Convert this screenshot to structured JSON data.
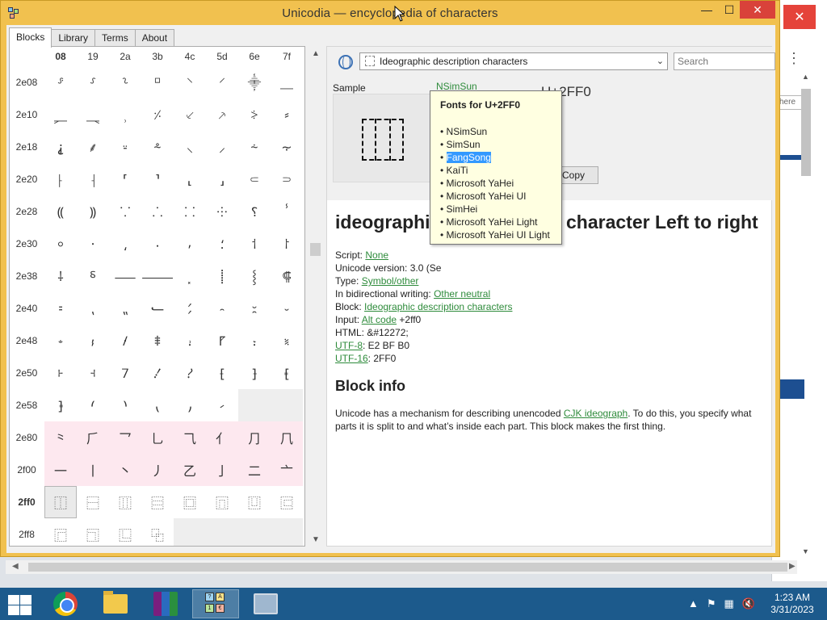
{
  "window": {
    "title": "Unicodia — encyclopedia of characters",
    "minimize": "—",
    "maximize": "☐",
    "close": "✕"
  },
  "tabs": [
    "Blocks",
    "Library",
    "Terms",
    "About"
  ],
  "grid": {
    "columns": [
      "08",
      "19",
      "2a",
      "3b",
      "4c",
      "5d",
      "6e",
      "7f"
    ],
    "rows": [
      {
        "label": "2e08",
        "cells": [
          "⸈",
          "⸉",
          "⸊",
          "⸋",
          "⸌",
          "⸍",
          "⸎",
          "⸏"
        ]
      },
      {
        "label": "2e10",
        "cells": [
          "⸐",
          "⸑",
          "⸒",
          "⸓",
          "⸔",
          "⸕",
          "⸖",
          "⸗"
        ]
      },
      {
        "label": "2e18",
        "cells": [
          "⸘",
          "⸙",
          "⸚",
          "⸛",
          "⸜",
          "⸝",
          "⸞",
          "⸟"
        ]
      },
      {
        "label": "2e20",
        "cells": [
          "⸠",
          "⸡",
          "⸢",
          "⸣",
          "⸤",
          "⸥",
          "⸦",
          "⸧"
        ]
      },
      {
        "label": "2e28",
        "cells": [
          "⸨",
          "⸩",
          "⸪",
          "⸫",
          "⸬",
          "⸭",
          "⸮",
          "ⸯ"
        ]
      },
      {
        "label": "2e30",
        "cells": [
          "⸰",
          "⸱",
          "⸲",
          "⸳",
          "⸴",
          "⸵",
          "⸶",
          "⸷"
        ]
      },
      {
        "label": "2e38",
        "cells": [
          "⸸",
          "⸹",
          "⸺",
          "⸻",
          "⸼",
          "⸽",
          "⸾",
          "⸿"
        ]
      },
      {
        "label": "2e40",
        "cells": [
          "⹀",
          "⹁",
          "⹂",
          "⹃",
          "⹄",
          "⹅",
          "⹆",
          "⹇"
        ]
      },
      {
        "label": "2e48",
        "cells": [
          "⹈",
          "⹉",
          "⹊",
          "⹋",
          "⹌",
          "⹍",
          "⹎",
          "⹏"
        ]
      },
      {
        "label": "2e50",
        "cells": [
          "⹐",
          "⹑",
          "⹒",
          "⹓",
          "⹔",
          "⹕",
          "⹖",
          "⹗"
        ]
      },
      {
        "label": "2e58",
        "cells": [
          "⹘",
          "⹙",
          "⹚",
          "⹛",
          "⹜",
          "⹝",
          "",
          ""
        ]
      },
      {
        "label": "2e80",
        "cells": [
          "⺀",
          "⺁",
          "⺂",
          "⺃",
          "⺄",
          "⺅",
          "⺆",
          "⺇"
        ]
      },
      {
        "label": "2f00",
        "cells": [
          "⼀",
          "⼁",
          "⼂",
          "⼃",
          "⼄",
          "⼅",
          "⼆",
          "⼇"
        ]
      },
      {
        "label": "2ff0",
        "cells": [
          "⿰",
          "⿱",
          "⿲",
          "⿳",
          "⿴",
          "⿵",
          "⿶",
          "⿷"
        ]
      },
      {
        "label": "2ff8",
        "cells": [
          "⿸",
          "⿹",
          "⿺",
          "⿻",
          "",
          "",
          "",
          ""
        ]
      }
    ]
  },
  "block_select": "Ideographic description characters",
  "search_placeholder": "Search",
  "sample_label": "Sample",
  "font_link": "NSimSun",
  "code_label": "U+2FF0",
  "copy_button": "Copy",
  "heading_start": "ideographi",
  "heading_end": "character Left to right",
  "props": {
    "script_label": "Script:",
    "script_value": "None",
    "version": "Unicode version: 3.0 (Se",
    "type_label": "Type:",
    "type_value": "Symbol/other",
    "bidi_label": "In bidirectional writing:",
    "bidi_value": "Other neutral",
    "block_label": "Block:",
    "block_value": "Ideographic description characters",
    "input_label": "Input:",
    "input_link": "Alt code",
    "input_value": "+2ff0",
    "html": "HTML: &#12272;",
    "utf8_link": "UTF-8",
    "utf8_value": ": E2 BF B0",
    "utf16_link": "UTF-16",
    "utf16_value": ": 2FF0"
  },
  "block_info": {
    "heading": "Block info",
    "text_before": "Unicode has a mechanism for describing unencoded ",
    "link": "CJK ideograph",
    "text_after": ". To do this, you specify what parts it is split to and what’s inside each part. This block makes the first thing."
  },
  "tooltip": {
    "title": "Fonts for U+2FF0",
    "fonts": [
      "NSimSun",
      "SimSun",
      "FangSong",
      "KaiTi",
      "Microsoft YaHei",
      "Microsoft YaHei UI",
      "SimHei",
      "Microsoft YaHei Light",
      "Microsoft YaHei UI Light"
    ],
    "highlighted": "FangSong"
  },
  "background_window": {
    "input_text": "here"
  },
  "taskbar": {
    "apps": [
      "chrome",
      "file-explorer",
      "winrar",
      "unicodia",
      "performance-monitor"
    ],
    "time": "1:23 AM",
    "date": "3/31/2023"
  },
  "colors": {
    "title_bar": "#f1c14f",
    "link": "#2e8b3b",
    "tooltip_bg": "#ffffe1",
    "taskbar": "#1c5a8c",
    "highlight": "#3399ff",
    "cjk_row_bg": "#fde8ef"
  }
}
